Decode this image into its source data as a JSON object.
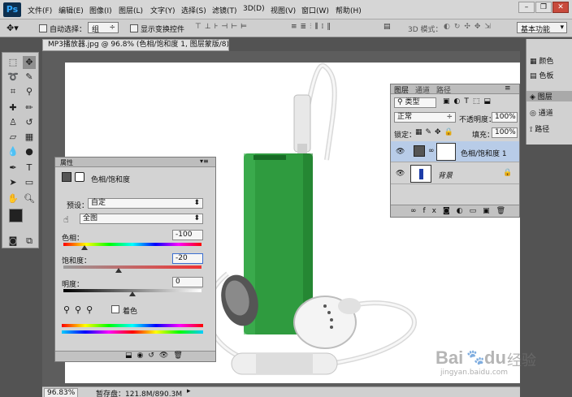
{
  "app": {
    "logo": "Ps"
  },
  "menu": [
    "文件(F)",
    "编辑(E)",
    "图像(I)",
    "图层(L)",
    "文字(Y)",
    "选择(S)",
    "滤镜(T)",
    "3D(D)",
    "视图(V)",
    "窗口(W)",
    "帮助(H)"
  ],
  "window_controls": [
    "minimize-icon",
    "restore-icon",
    "close-icon"
  ],
  "options": {
    "auto_select_label": "自动选择：",
    "auto_select_value": "组",
    "show_transform_label": "显示变换控件",
    "mode_3d_label": "3D 模式：",
    "workspace_value": "基本功能"
  },
  "document_tab": {
    "title": "MP3播放器.jpg @ 96.8% (色相/饱和度 1, 图层蒙版/8) *",
    "close": "×"
  },
  "status": {
    "zoom": "96.83%",
    "scratch": "暂存盘：121.8M/890.3M"
  },
  "right_dock": {
    "items": [
      "颜色",
      "色板",
      "图层",
      "通道",
      "路径"
    ]
  },
  "properties": {
    "tab": "属性",
    "title": "色相/饱和度",
    "preset_label": "预设：",
    "preset_value": "自定",
    "channel_value": "全图",
    "hue_label": "色相：",
    "hue_value": "-100",
    "saturation_label": "饱和度：",
    "saturation_value": "-20",
    "lightness_label": "明度：",
    "lightness_value": "0",
    "colorize_label": "着色",
    "hue_fraction": 0.15,
    "saturation_fraction": 0.4,
    "lightness_fraction": 0.5
  },
  "layers": {
    "tabs": [
      "图层",
      "通道",
      "路径"
    ],
    "filter_label": "类型",
    "blend_mode": "正常",
    "opacity_label": "不透明度：",
    "opacity_value": "100%",
    "lock_label": "锁定：",
    "fill_label": "填充：",
    "fill_value": "100%",
    "rows": [
      {
        "name": "色相/饱和度 1",
        "selected": true
      },
      {
        "name": "背景",
        "selected": false
      }
    ]
  },
  "watermark": {
    "brand": "Bai",
    "paw": "du",
    "suffix": "经验",
    "url": "jingyan.baidu.com"
  },
  "colors": {
    "accent": "#31a8ff",
    "selected_row": "#b8cce8",
    "green_player": "#2f9b3f"
  }
}
